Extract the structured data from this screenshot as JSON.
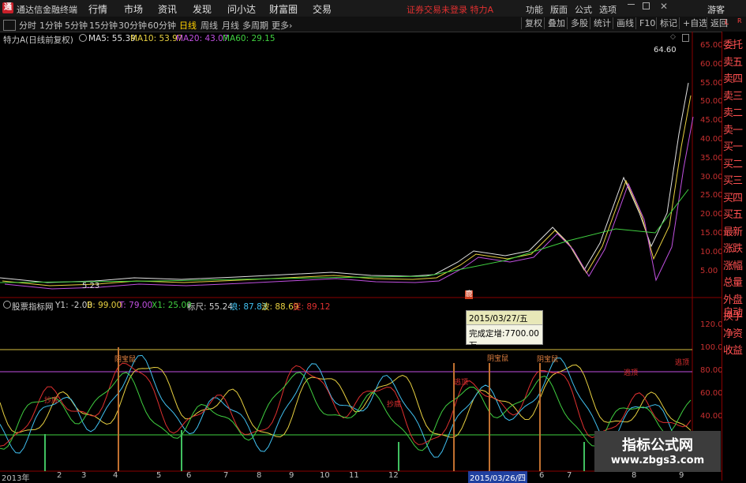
{
  "titlebar": {
    "app_title": "通达信金融终端",
    "logo_glyph": "通",
    "menu": [
      "行情",
      "市场",
      "资讯",
      "发现",
      "问小达",
      "财富圈",
      "交易"
    ],
    "status": "证券交易未登录  特力A",
    "right_menu": [
      "功能",
      "版面",
      "公式",
      "选项"
    ],
    "guest": "游客"
  },
  "toolbar": {
    "periods": [
      "分时",
      "1分钟",
      "5分钟",
      "15分钟",
      "30分钟",
      "60分钟",
      "日线",
      "周线",
      "月线",
      "多周期",
      "更多›"
    ],
    "active_period": "日线",
    "right_buttons": [
      "复权",
      "叠加",
      "多股",
      "统计",
      "画线",
      "F10",
      "标记",
      "+自选",
      "返回"
    ]
  },
  "main_chart": {
    "legend": [
      {
        "text": "特力A(日线前复权)",
        "color": "#d0d0d0"
      },
      {
        "text": "MA5: 55.39",
        "color": "#e0e0e0"
      },
      {
        "text": "MA10: 53.97",
        "color": "#e8d040"
      },
      {
        "text": "MA20: 43.07",
        "color": "#c050e0"
      },
      {
        "text": "MA60: 29.15",
        "color": "#40d040"
      }
    ],
    "y_ticks": [
      "65.00",
      "60.00",
      "55.00",
      "50.00",
      "45.00",
      "40.00",
      "35.00",
      "30.00",
      "25.00",
      "20.00",
      "15.00",
      "10.00",
      "5.00"
    ],
    "high_label": "64.60",
    "low_label": "5.23",
    "marker": "鹿"
  },
  "indicator": {
    "legend": [
      {
        "text": "股票指标网",
        "color": "#d0d0d0"
      },
      {
        "text": "Y1: -2.00",
        "color": "#d0d0d0"
      },
      {
        "text": "B: 99.00",
        "color": "#e8d040"
      },
      {
        "text": "T: 79.00",
        "color": "#c050e0"
      },
      {
        "text": "X1: 25.00",
        "color": "#40d040"
      },
      {
        "text": "标尺: 55.24",
        "color": "#d0d0d0"
      },
      {
        "text": "浪: 87.83",
        "color": "#40c0f0"
      },
      {
        "text": "波: 88.69",
        "color": "#e8d040"
      },
      {
        "text": "捉: 89.12",
        "color": "#e03030"
      }
    ],
    "y_ticks": [
      "120.00",
      "100.00",
      "80.00",
      "60.00",
      "40.00"
    ],
    "tooltip_date": "2015/03/27/五",
    "tooltip_text": "完成定增:7700.00万",
    "signal_labels": [
      "阴宝鼠",
      "阴宝鼠",
      "阴宝鼠",
      "逃顶",
      "逃顶",
      "逃顶",
      "抄底",
      "抄底"
    ]
  },
  "x_axis": {
    "labels": [
      "2013年",
      "2",
      "3",
      "4",
      "5",
      "6",
      "7",
      "8",
      "9",
      "10",
      "11",
      "12",
      "2015/03/26/四",
      "6",
      "7",
      "8",
      "9"
    ]
  },
  "right_panel": {
    "letters": [
      "L",
      "R"
    ],
    "items": [
      "委托",
      "卖五",
      "卖四",
      "卖三",
      "卖二",
      "卖一",
      "买一",
      "买二",
      "买三",
      "买四",
      "买五",
      "最新",
      "涨跌",
      "涨幅",
      "总量",
      "外盘",
      "换手",
      "净资",
      "收益",
      "自动"
    ]
  },
  "watermark": {
    "title": "指标公式网",
    "url": "www.zbgs3.com"
  }
}
